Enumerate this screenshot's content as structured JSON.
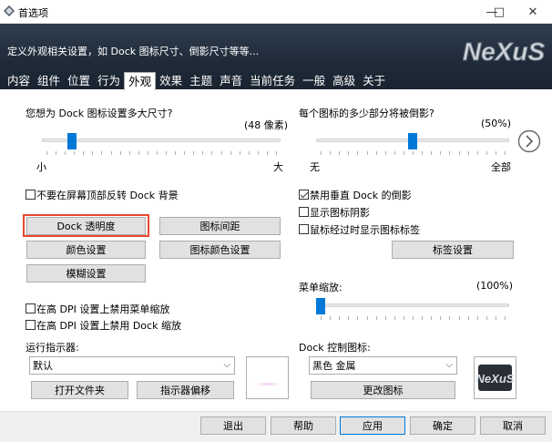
{
  "window": {
    "title": "首选项",
    "subtitle": "定义外观相关设置，如 Dock 图标尺寸、倒影尺寸等等...",
    "logo_text": "NeXuS"
  },
  "tabs": [
    {
      "label": "内容"
    },
    {
      "label": "组件"
    },
    {
      "label": "位置"
    },
    {
      "label": "行为"
    },
    {
      "label": "外观",
      "active": true
    },
    {
      "label": "效果"
    },
    {
      "label": "主题"
    },
    {
      "label": "声音"
    },
    {
      "label": "当前任务"
    },
    {
      "label": "一般"
    },
    {
      "label": "高级"
    },
    {
      "label": "关于"
    }
  ],
  "left": {
    "icon_size_question": "您想为 Dock 图标设置多大尺寸?",
    "icon_size_value": "(48 像素)",
    "icon_size_fraction": 0.11,
    "slider_min_label": "小",
    "slider_max_label": "大",
    "flip_bg_label": "不要在屏幕顶部反转 Dock 背景",
    "flip_bg_checked": false,
    "buttons": {
      "dock_transparency": "Dock 透明度",
      "icon_spacing": "图标间距",
      "color_settings": "颜色设置",
      "icon_color_settings": "图标颜色设置",
      "blur_settings": "模糊设置"
    },
    "dpi_menu_label": "在高 DPI 设置上禁用菜单缩放",
    "dpi_menu_checked": false,
    "dpi_dock_label": "在高 DPI 设置上禁用 Dock 缩放",
    "dpi_dock_checked": false,
    "run_indicator_label": "运行指示器:",
    "run_indicator_value": "默认",
    "open_folder_button": "打开文件夹",
    "indicator_offset_button": "指示器偏移"
  },
  "right": {
    "reflection_question": "每个图标的多少部分将被倒影?",
    "reflection_value": "(50%)",
    "reflection_fraction": 0.5,
    "slider_min_label": "无",
    "slider_max_label": "全部",
    "disable_reflection_label": "禁用垂直 Dock 的倒影",
    "disable_reflection_checked": true,
    "show_shadow_label": "显示图标阴影",
    "show_shadow_checked": false,
    "show_label_hover_label": "鼠标经过时显示图标标签",
    "show_label_hover_checked": false,
    "label_settings_button": "标签设置",
    "menu_scale_label": "菜单缩放:",
    "menu_scale_value": "(100%)",
    "menu_scale_fraction": 0.0,
    "dock_control_icon_label": "Dock 控制图标:",
    "dock_control_icon_value": "黑色 金属",
    "change_icon_button": "更改图标"
  },
  "footer": {
    "exit": "退出",
    "help": "帮助",
    "apply": "应用",
    "ok": "确定",
    "cancel": "取消"
  },
  "colors": {
    "accent": "#0078d7",
    "highlight_border": "#e8472f",
    "header_bg": "#1f2a38"
  }
}
